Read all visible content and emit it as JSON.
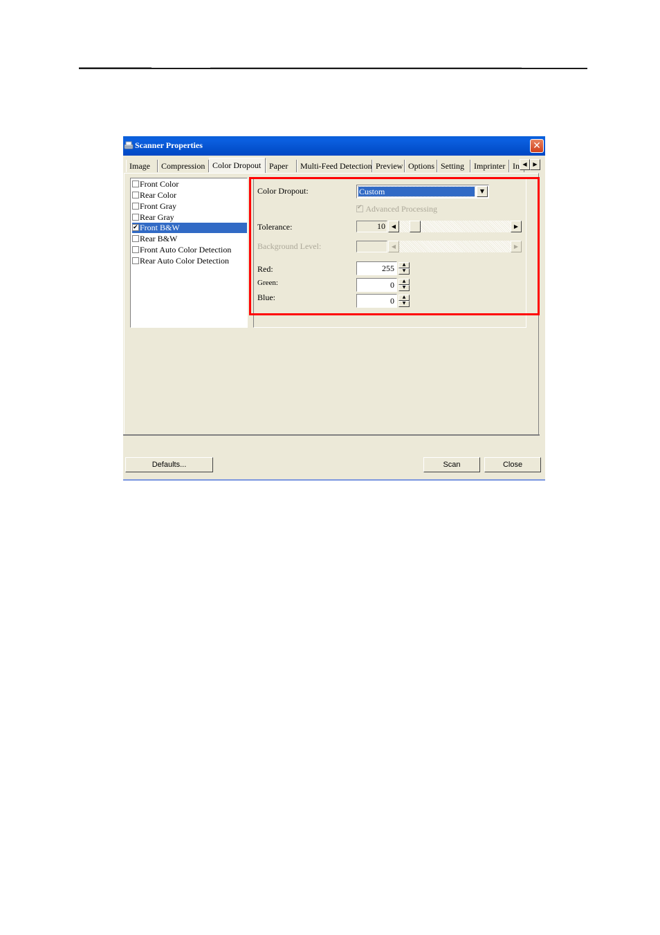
{
  "window": {
    "title": "Scanner Properties",
    "close_label": "✕"
  },
  "tabs": [
    {
      "label": "Image",
      "active": false
    },
    {
      "label": "Compression",
      "active": false
    },
    {
      "label": "Color Dropout",
      "active": true
    },
    {
      "label": "Paper",
      "active": false
    },
    {
      "label": "Multi-Feed Detection",
      "active": false
    },
    {
      "label": "Preview",
      "active": false
    },
    {
      "label": "Options",
      "active": false
    },
    {
      "label": "Setting",
      "active": false
    },
    {
      "label": "Imprinter",
      "active": false
    },
    {
      "label": "In",
      "active": false
    }
  ],
  "tab_scroll": {
    "left": "◀",
    "right": "▶"
  },
  "image_list": [
    {
      "label": "Front Color",
      "checked": false,
      "selected": false
    },
    {
      "label": "Rear Color",
      "checked": false,
      "selected": false
    },
    {
      "label": "Front Gray",
      "checked": false,
      "selected": false
    },
    {
      "label": "Rear Gray",
      "checked": false,
      "selected": false
    },
    {
      "label": "Front B&W",
      "checked": true,
      "selected": true
    },
    {
      "label": "Rear B&W",
      "checked": false,
      "selected": false
    },
    {
      "label": "Front Auto Color Detection",
      "checked": false,
      "selected": false
    },
    {
      "label": "Rear Auto Color Detection",
      "checked": false,
      "selected": false
    }
  ],
  "color_dropout": {
    "label": "Color Dropout:",
    "value": "Custom",
    "arrow": "▼"
  },
  "advanced_processing": {
    "label": "Advanced Processing",
    "checked": true,
    "enabled": false
  },
  "tolerance": {
    "label": "Tolerance:",
    "value": "10",
    "slider_fraction": 0.1,
    "left_arrow": "◀",
    "right_arrow": "▶"
  },
  "background_level": {
    "label": "Background Level:",
    "value": "",
    "enabled": false,
    "left_arrow": "◀",
    "right_arrow": "▶"
  },
  "rgb": [
    {
      "label": "Red:",
      "value": "255"
    },
    {
      "label": "Green:",
      "value": "0"
    },
    {
      "label": "Blue:",
      "value": "0"
    }
  ],
  "spin_glyphs": {
    "up": "▲",
    "down": "▼"
  },
  "buttons": {
    "defaults": "Defaults...",
    "scan": "Scan",
    "close": "Close"
  },
  "highlight_color": "#ff0000",
  "accent_color": "#316ac5"
}
